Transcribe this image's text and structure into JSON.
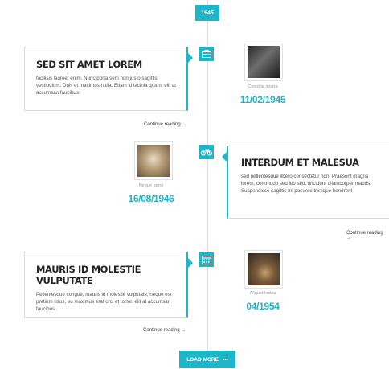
{
  "timeline": {
    "year": "1945",
    "load_more": "LOAD MORE",
    "load_more_dots": "•••"
  },
  "entries": [
    {
      "title": "SED SIT AMET LOREM",
      "text": "facilisis laoreet enim. Nunc porta sem non justo sagittis vestibulum. Duis et maximus nulla. Etiam id lacinia quam. elit at accumsan faucibus",
      "continue": "Continue reading →",
      "caption": "Conubia nostra",
      "date": "11/02/1945",
      "icon": "briefcase-icon"
    },
    {
      "title": "INTERDUM ET MALESUA",
      "text": "sed pellentesque libero consectetur non. Praesent magna lorem, commodo sed leo sed, tincidunt ullamcorper mauris. Suspendisse sagittis mi posuere tristique hendrerit",
      "continue": "Continue reading →",
      "caption": "Neque porro",
      "date": "16/08/1946",
      "icon": "bicycle-icon"
    },
    {
      "title": "MAURIS ID MOLESTIE VULPUTATE",
      "text": "Pellentesque congue, mauris id molestie vulputate, neque est pretium risus, eu maximus erat orci et tortor. elit at accumsan faucibus",
      "continue": "Continue reading →",
      "caption": "Aliquet lectus",
      "date": "04/1954",
      "icon": "calendar-icon"
    }
  ],
  "colors": {
    "accent": "#1fb5c9",
    "line": "#dcdcdc"
  }
}
